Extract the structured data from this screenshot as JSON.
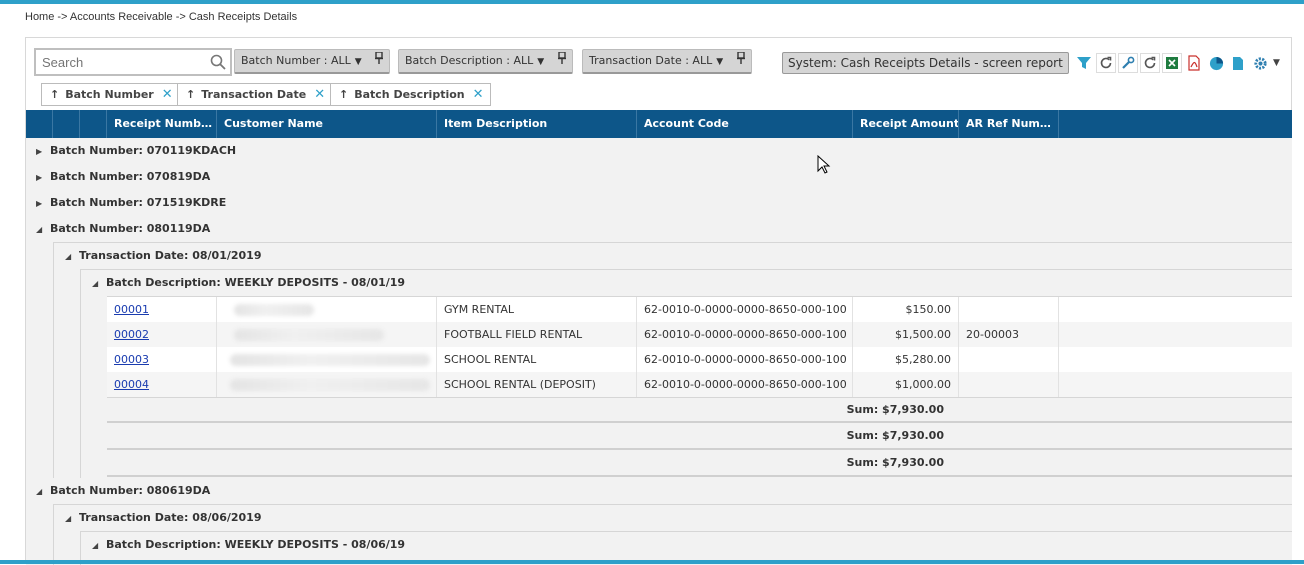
{
  "breadcrumb": "Home -> Accounts Receivable -> Cash Receipts Details",
  "search": {
    "placeholder": "Search"
  },
  "filters": [
    {
      "label": "Batch Number : ALL"
    },
    {
      "label": "Batch Description : ALL"
    },
    {
      "label": "Transaction Date : ALL"
    }
  ],
  "system_report": "System: Cash Receipts Details - screen report",
  "toolbar_icons": [
    "filter-icon",
    "refresh-icon",
    "wrench-icon",
    "refresh-icon",
    "excel-icon",
    "pdf-icon",
    "chart-icon",
    "document-icon",
    "gear-icon"
  ],
  "sort_chips": [
    {
      "label": "Batch Number"
    },
    {
      "label": "Transaction Date"
    },
    {
      "label": "Batch Description"
    }
  ],
  "columns": [
    "Receipt Numb…",
    "Customer Name",
    "Item Description",
    "Account Code",
    "Receipt Amount",
    "AR Ref Num…"
  ],
  "batches_collapsed": [
    "Batch Number: 070119KDACH",
    "Batch Number: 070819DA",
    "Batch Number: 071519KDRE"
  ],
  "batch_open": {
    "label": "Batch Number: 080119DA",
    "date": "Transaction Date: 08/01/2019",
    "desc": "Batch Description: WEEKLY DEPOSITS - 08/01/19",
    "rows": [
      {
        "receipt": "00001",
        "item": "GYM RENTAL",
        "account": "62-0010-0-0000-0000-8650-000-100",
        "amount": "$150.00",
        "ref": ""
      },
      {
        "receipt": "00002",
        "item": "FOOTBALL FIELD RENTAL",
        "account": "62-0010-0-0000-0000-8650-000-100",
        "amount": "$1,500.00",
        "ref": "20-00003"
      },
      {
        "receipt": "00003",
        "item": "SCHOOL RENTAL",
        "account": "62-0010-0-0000-0000-8650-000-100",
        "amount": "$5,280.00",
        "ref": ""
      },
      {
        "receipt": "00004",
        "item": "SCHOOL RENTAL (DEPOSIT)",
        "account": "62-0010-0-0000-0000-8650-000-100",
        "amount": "$1,000.00",
        "ref": ""
      }
    ],
    "sums": [
      "Sum: $7,930.00",
      "Sum: $7,930.00",
      "Sum: $7,930.00"
    ]
  },
  "batch_next": {
    "label": "Batch Number: 080619DA",
    "date": "Transaction Date: 08/06/2019",
    "desc": "Batch Description: WEEKLY DEPOSITS - 08/06/19"
  },
  "colors": {
    "header_bg": "#0d5689",
    "accent": "#2ea0c9",
    "link": "#1a3cb0"
  }
}
